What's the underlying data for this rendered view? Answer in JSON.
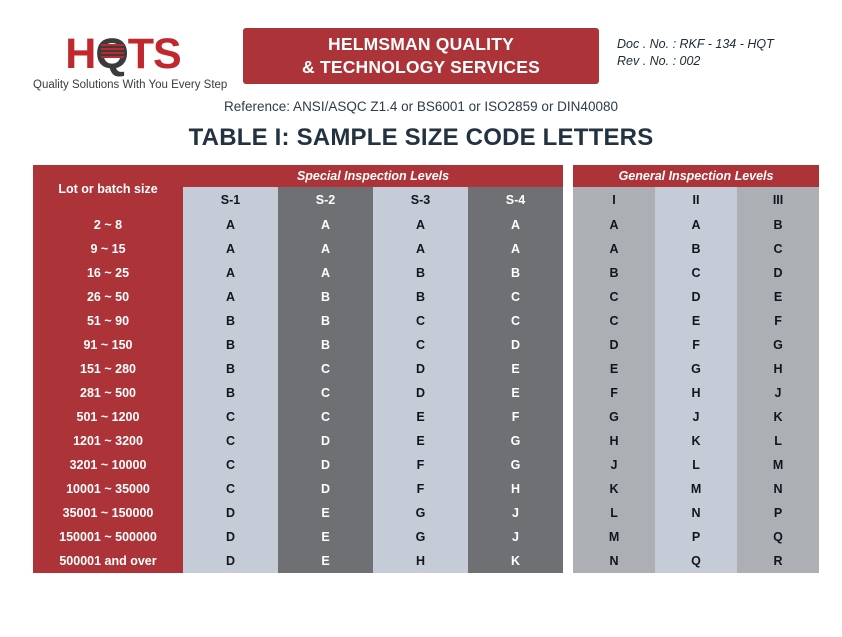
{
  "header": {
    "logo": {
      "name": "HQTS",
      "letters_before_q": "H",
      "q_letter": "Q",
      "letters_after_q": "TS",
      "tagline": "Quality Solutions With You Every Step",
      "red": "#c0282d",
      "dark": "#3b3b3d"
    },
    "banner": {
      "line1": "HELMSMAN QUALITY",
      "line2": "& TECHNOLOGY SERVICES",
      "background": "#ac3338",
      "text_color": "#ffffff"
    },
    "doc": {
      "doc_no": "Doc . No. : RKF - 134 - HQT",
      "rev_no": "Rev . No. : 002"
    }
  },
  "reference": "Reference: ANSI/ASQC Z1.4 or BS6001 or ISO2859 or DIN40080",
  "title": "TABLE I: SAMPLE SIZE CODE LETTERS",
  "table": {
    "corner_label": "Lot or batch size",
    "groups": [
      {
        "label": "Special Inspection Levels",
        "columns": [
          "S-1",
          "S-2",
          "S-3",
          "S-4"
        ]
      },
      {
        "label": "General Inspection Levels",
        "columns": [
          "I",
          "II",
          "III"
        ]
      }
    ],
    "column_shades": [
      "light",
      "dark",
      "light",
      "dark",
      "mid",
      "light",
      "mid"
    ],
    "palette": {
      "red": "#ac3338",
      "light": "#c6ccd7",
      "dark": "#6e7074",
      "mid": "#acb0b5"
    },
    "rows": [
      {
        "label": "2 ~ 8",
        "values": [
          "A",
          "A",
          "A",
          "A",
          "A",
          "A",
          "B"
        ]
      },
      {
        "label": "9 ~ 15",
        "values": [
          "A",
          "A",
          "A",
          "A",
          "A",
          "B",
          "C"
        ]
      },
      {
        "label": "16 ~ 25",
        "values": [
          "A",
          "A",
          "B",
          "B",
          "B",
          "C",
          "D"
        ]
      },
      {
        "label": "26 ~ 50",
        "values": [
          "A",
          "B",
          "B",
          "C",
          "C",
          "D",
          "E"
        ]
      },
      {
        "label": "51 ~ 90",
        "values": [
          "B",
          "B",
          "C",
          "C",
          "C",
          "E",
          "F"
        ]
      },
      {
        "label": "91 ~ 150",
        "values": [
          "B",
          "B",
          "C",
          "D",
          "D",
          "F",
          "G"
        ]
      },
      {
        "label": "151 ~ 280",
        "values": [
          "B",
          "C",
          "D",
          "E",
          "E",
          "G",
          "H"
        ]
      },
      {
        "label": "281 ~ 500",
        "values": [
          "B",
          "C",
          "D",
          "E",
          "F",
          "H",
          "J"
        ]
      },
      {
        "label": "501 ~ 1200",
        "values": [
          "C",
          "C",
          "E",
          "F",
          "G",
          "J",
          "K"
        ]
      },
      {
        "label": "1201 ~ 3200",
        "values": [
          "C",
          "D",
          "E",
          "G",
          "H",
          "K",
          "L"
        ]
      },
      {
        "label": "3201 ~ 10000",
        "values": [
          "C",
          "D",
          "F",
          "G",
          "J",
          "L",
          "M"
        ]
      },
      {
        "label": "10001 ~ 35000",
        "values": [
          "C",
          "D",
          "F",
          "H",
          "K",
          "M",
          "N"
        ]
      },
      {
        "label": "35001 ~ 150000",
        "values": [
          "D",
          "E",
          "G",
          "J",
          "L",
          "N",
          "P"
        ]
      },
      {
        "label": "150001 ~ 500000",
        "values": [
          "D",
          "E",
          "G",
          "J",
          "M",
          "P",
          "Q"
        ]
      },
      {
        "label": "500001 and over",
        "values": [
          "D",
          "E",
          "H",
          "K",
          "N",
          "Q",
          "R"
        ]
      }
    ]
  }
}
